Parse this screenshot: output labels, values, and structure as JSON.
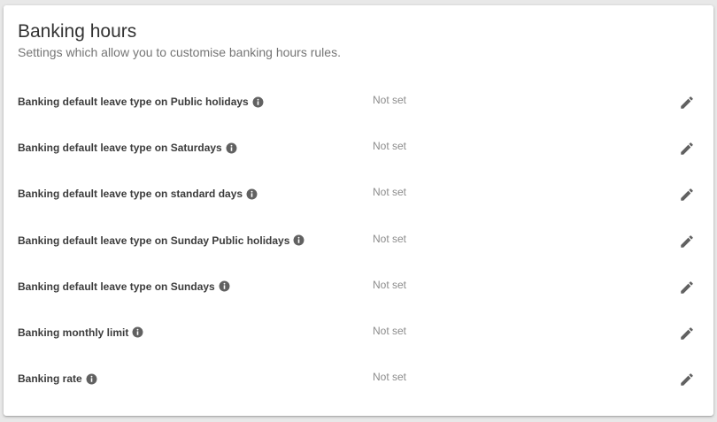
{
  "section": {
    "title": "Banking hours",
    "subtitle": "Settings which allow you to customise banking hours rules."
  },
  "colors": {
    "title": "#333333",
    "subtitle": "#757575",
    "label": "#3c3c3c",
    "value": "#8c8c8c",
    "icon": "#616161"
  },
  "settings": [
    {
      "label": "Banking default leave type on Public holidays",
      "value": "Not set",
      "info_icon": "info-icon",
      "action_icon": "pencil-icon"
    },
    {
      "label": "Banking default leave type on Saturdays",
      "value": "Not set",
      "info_icon": "info-icon",
      "action_icon": "pencil-icon"
    },
    {
      "label": "Banking default leave type on standard days",
      "value": "Not set",
      "info_icon": "info-icon",
      "action_icon": "pencil-icon"
    },
    {
      "label": "Banking default leave type on Sunday Public holidays",
      "value": "Not set",
      "info_icon": "info-icon",
      "action_icon": "pencil-icon"
    },
    {
      "label": "Banking default leave type on Sundays",
      "value": "Not set",
      "info_icon": "info-icon",
      "action_icon": "pencil-icon"
    },
    {
      "label": "Banking monthly limit",
      "value": "Not set",
      "info_icon": "info-icon",
      "action_icon": "pencil-icon"
    },
    {
      "label": "Banking rate",
      "value": "Not set",
      "info_icon": "info-icon",
      "action_icon": "pencil-icon"
    }
  ]
}
